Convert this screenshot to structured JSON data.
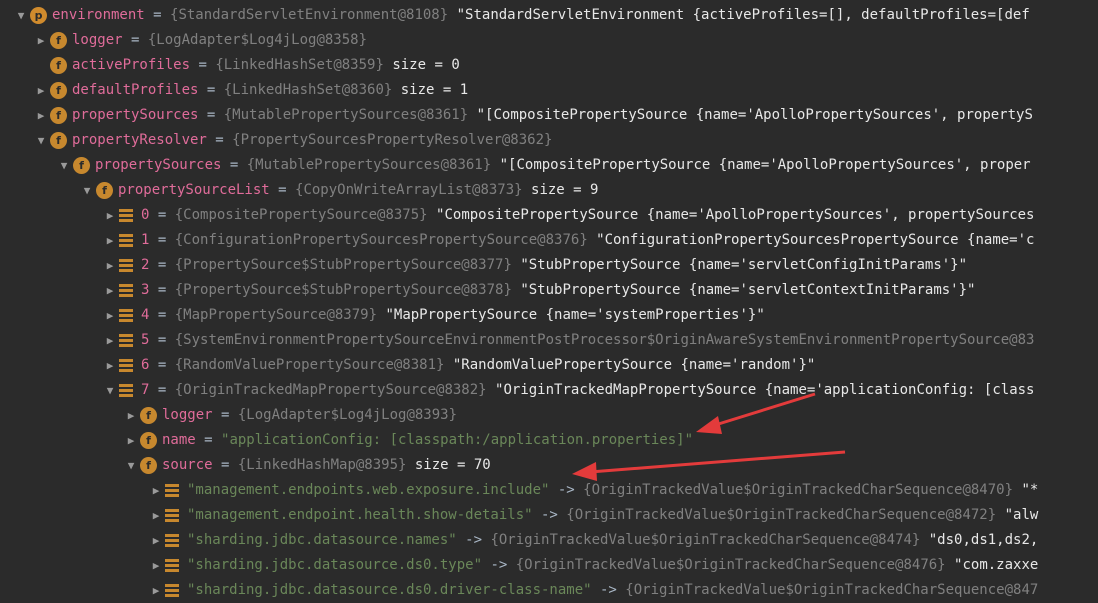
{
  "colors": {
    "background": "#2b2b2b",
    "field_name": "#e06c9a",
    "reference": "#808080",
    "annotation_arrow": "#e33b3b"
  },
  "rows": [
    {
      "indent": 0,
      "arrow": "down",
      "icon": "p",
      "name": "environment",
      "eq": " = ",
      "ref": "{StandardServletEnvironment@8108}",
      "val": " \"StandardServletEnvironment {activeProfiles=[], defaultProfiles=[def"
    },
    {
      "indent": 1,
      "arrow": "right",
      "icon": "f",
      "name": "logger",
      "eq": " = ",
      "ref": "{LogAdapter$Log4jLog@8358}",
      "val": ""
    },
    {
      "indent": 1,
      "arrow": "none",
      "icon": "f",
      "name": "activeProfiles",
      "eq": " = ",
      "ref": "{LinkedHashSet@8359}",
      "val": "  size = 0"
    },
    {
      "indent": 1,
      "arrow": "right",
      "icon": "f",
      "name": "defaultProfiles",
      "eq": " = ",
      "ref": "{LinkedHashSet@8360}",
      "val": "  size = 1"
    },
    {
      "indent": 1,
      "arrow": "right",
      "icon": "f",
      "name": "propertySources",
      "eq": " = ",
      "ref": "{MutablePropertySources@8361}",
      "val": " \"[CompositePropertySource {name='ApolloPropertySources', propertyS"
    },
    {
      "indent": 1,
      "arrow": "down",
      "icon": "f",
      "name": "propertyResolver",
      "eq": " = ",
      "ref": "{PropertySourcesPropertyResolver@8362}",
      "val": ""
    },
    {
      "indent": 2,
      "arrow": "down",
      "icon": "f",
      "name": "propertySources",
      "eq": " = ",
      "ref": "{MutablePropertySources@8361}",
      "val": " \"[CompositePropertySource {name='ApolloPropertySources', proper"
    },
    {
      "indent": 3,
      "arrow": "down",
      "icon": "f",
      "name": "propertySourceList",
      "eq": " = ",
      "ref": "{CopyOnWriteArrayList@8373}",
      "val": "  size = 9"
    },
    {
      "indent": 4,
      "arrow": "right",
      "icon": "list",
      "name": "0",
      "eq": " = ",
      "ref": "{CompositePropertySource@8375}",
      "val": " \"CompositePropertySource {name='ApolloPropertySources', propertySources"
    },
    {
      "indent": 4,
      "arrow": "right",
      "icon": "list",
      "name": "1",
      "eq": " = ",
      "ref": "{ConfigurationPropertySourcesPropertySource@8376}",
      "val": " \"ConfigurationPropertySourcesPropertySource {name='c"
    },
    {
      "indent": 4,
      "arrow": "right",
      "icon": "list",
      "name": "2",
      "eq": " = ",
      "ref": "{PropertySource$StubPropertySource@8377}",
      "val": " \"StubPropertySource {name='servletConfigInitParams'}\""
    },
    {
      "indent": 4,
      "arrow": "right",
      "icon": "list",
      "name": "3",
      "eq": " = ",
      "ref": "{PropertySource$StubPropertySource@8378}",
      "val": " \"StubPropertySource {name='servletContextInitParams'}\""
    },
    {
      "indent": 4,
      "arrow": "right",
      "icon": "list",
      "name": "4",
      "eq": " = ",
      "ref": "{MapPropertySource@8379}",
      "val": " \"MapPropertySource {name='systemProperties'}\""
    },
    {
      "indent": 4,
      "arrow": "right",
      "icon": "list",
      "name": "5",
      "eq": " = ",
      "ref": "{SystemEnvironmentPropertySourceEnvironmentPostProcessor$OriginAwareSystemEnvironmentPropertySource@83",
      "val": ""
    },
    {
      "indent": 4,
      "arrow": "right",
      "icon": "list",
      "name": "6",
      "eq": " = ",
      "ref": "{RandomValuePropertySource@8381}",
      "val": " \"RandomValuePropertySource {name='random'}\""
    },
    {
      "indent": 4,
      "arrow": "down",
      "icon": "list",
      "name": "7",
      "eq": " = ",
      "ref": "{OriginTrackedMapPropertySource@8382}",
      "val": " \"OriginTrackedMapPropertySource {name='applicationConfig: [class"
    },
    {
      "indent": 5,
      "arrow": "right",
      "icon": "f",
      "name": "logger",
      "eq": " = ",
      "ref": "{LogAdapter$Log4jLog@8393}",
      "val": ""
    },
    {
      "indent": 5,
      "arrow": "right",
      "icon": "f",
      "name": "name",
      "eq": " = ",
      "ref": "",
      "val": "\"applicationConfig: [classpath:/application.properties]\""
    },
    {
      "indent": 5,
      "arrow": "down",
      "icon": "f",
      "name": "source",
      "eq": " = ",
      "ref": "{LinkedHashMap@8395}",
      "val": "  size = 70"
    },
    {
      "indent": 6,
      "arrow": "right",
      "icon": "list",
      "name": "\"management.endpoints.web.exposure.include\"",
      "eq": " -> ",
      "ref": "{OriginTrackedValue$OriginTrackedCharSequence@8470}",
      "val": " \"*"
    },
    {
      "indent": 6,
      "arrow": "right",
      "icon": "list",
      "name": "\"management.endpoint.health.show-details\"",
      "eq": " -> ",
      "ref": "{OriginTrackedValue$OriginTrackedCharSequence@8472}",
      "val": " \"alw"
    },
    {
      "indent": 6,
      "arrow": "right",
      "icon": "list",
      "name": "\"sharding.jdbc.datasource.names\"",
      "eq": " -> ",
      "ref": "{OriginTrackedValue$OriginTrackedCharSequence@8474}",
      "val": " \"ds0,ds1,ds2,"
    },
    {
      "indent": 6,
      "arrow": "right",
      "icon": "list",
      "name": "\"sharding.jdbc.datasource.ds0.type\"",
      "eq": " -> ",
      "ref": "{OriginTrackedValue$OriginTrackedCharSequence@8476}",
      "val": " \"com.zaxxe"
    },
    {
      "indent": 6,
      "arrow": "right",
      "icon": "list",
      "name": "\"sharding.jdbc.datasource.ds0.driver-class-name\"",
      "eq": " -> ",
      "ref": "{OriginTrackedValue$OriginTrackedCharSequence@847",
      "val": ""
    }
  ]
}
